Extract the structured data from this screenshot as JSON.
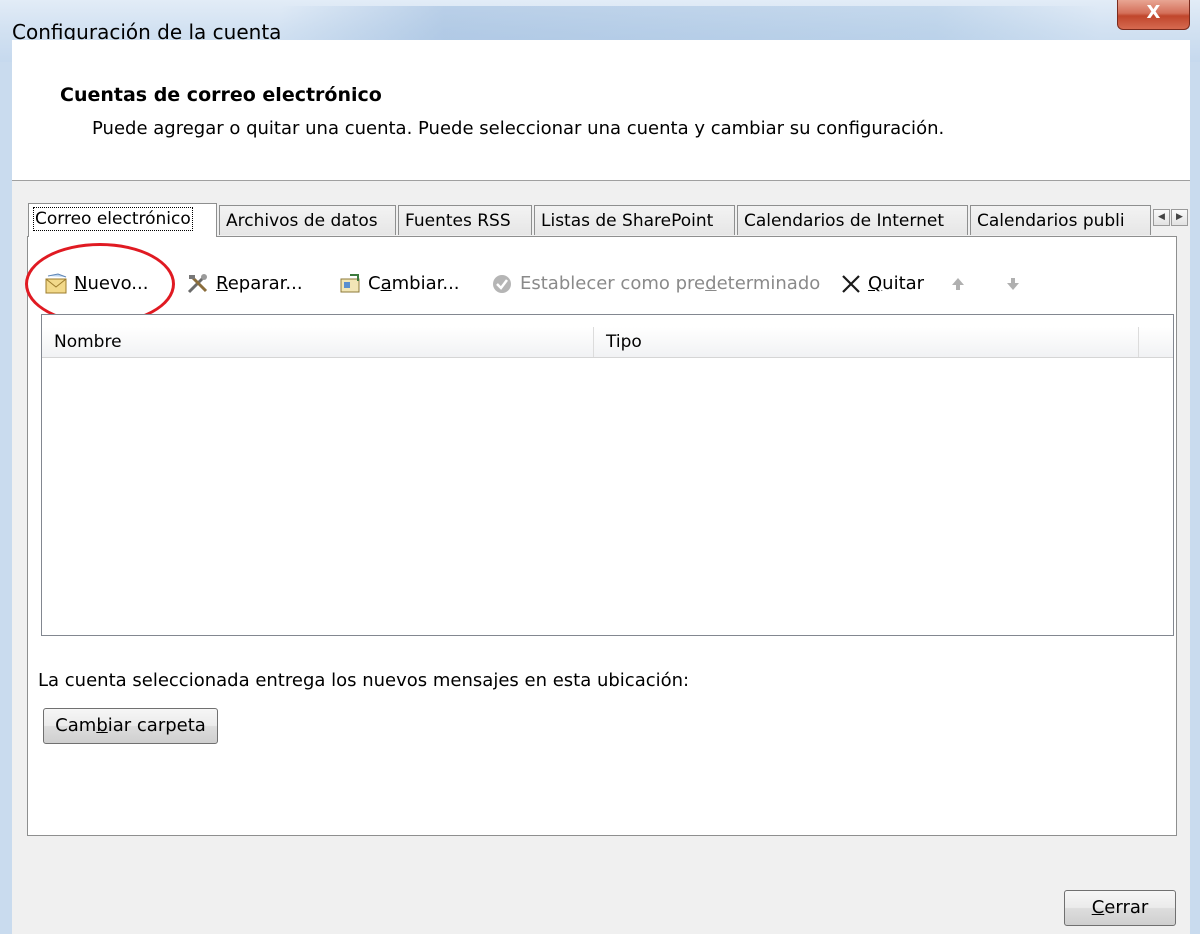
{
  "window": {
    "title": "Configuración de la cuenta",
    "close_glyph": "X"
  },
  "header": {
    "heading": "Cuentas de correo electrónico",
    "description": "Puede agregar o quitar una cuenta. Puede seleccionar una cuenta y cambiar su configuración."
  },
  "tabs": [
    {
      "label": "Correo electrónico",
      "active": true
    },
    {
      "label": "Archivos de datos"
    },
    {
      "label": "Fuentes RSS"
    },
    {
      "label": "Listas de SharePoint"
    },
    {
      "label": "Calendarios de Internet"
    },
    {
      "label": "Calendarios publi"
    }
  ],
  "toolbar": {
    "new": {
      "pre": "",
      "key": "N",
      "post": "uevo...",
      "icon": "new-mail-icon"
    },
    "repair": {
      "pre": "",
      "key": "R",
      "post": "eparar...",
      "icon": "tools-icon"
    },
    "change": {
      "pre": "C",
      "key": "a",
      "post": "mbiar...",
      "icon": "change-account-icon"
    },
    "set_default": {
      "pre": "Establecer como pre",
      "key": "d",
      "post": "eterminado",
      "icon": "check-circle-icon",
      "disabled": true
    },
    "remove": {
      "pre": "",
      "key": "Q",
      "post": "uitar",
      "icon": "x-icon"
    },
    "up_icon": "arrow-up-icon",
    "down_icon": "arrow-down-icon"
  },
  "list": {
    "columns": [
      "Nombre",
      "Tipo"
    ],
    "rows": []
  },
  "delivery_note": "La cuenta seleccionada entrega los nuevos mensajes en esta ubicación:",
  "change_folder": {
    "pre": "Cam",
    "key": "b",
    "post": "iar carpeta"
  },
  "close": {
    "pre": "",
    "key": "C",
    "post": "errar"
  },
  "colors": {
    "annotation_circle": "#e01a22",
    "title_bar": "#d3e2f2",
    "dialog_bg": "#f0f0f0"
  }
}
